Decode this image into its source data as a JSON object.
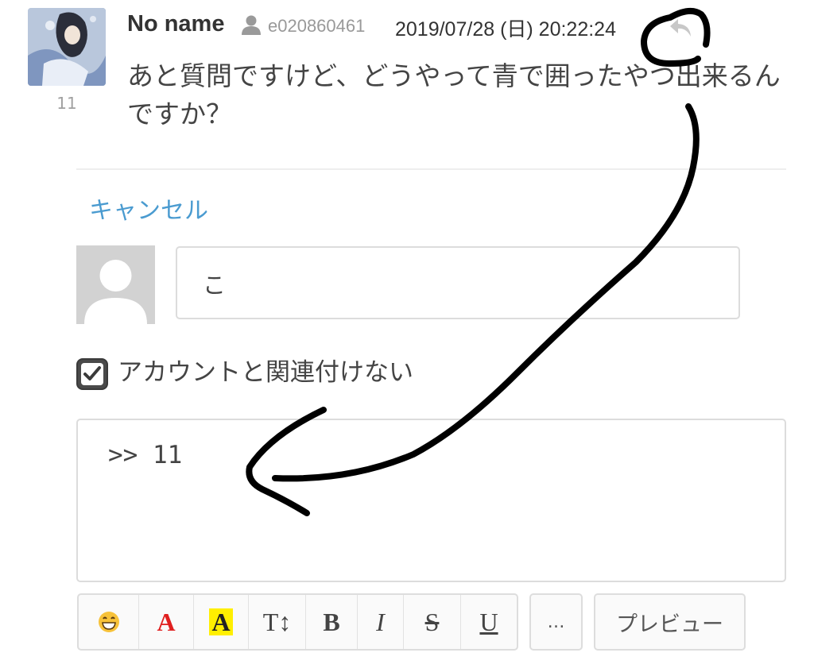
{
  "comment": {
    "author": "No name",
    "user_id": "e020860461",
    "date": "2019/07/28 (日) 20:22:24",
    "post_number": "11",
    "body": "あと質問ですけど、どうやって青で囲ったやつ出来るんですか？"
  },
  "reply_form": {
    "cancel_label": "キャンセル",
    "name_value": "こ",
    "anon_checked": true,
    "anon_label": "アカウントと関連付けない",
    "reply_value": ">> 11"
  },
  "toolbar": {
    "emoji_icon": "smiley-icon",
    "font_color": "A",
    "font_color_hex": "#e02020",
    "highlight": "A",
    "highlight_hex": "#ffef00",
    "font_size": "T↕",
    "bold": "B",
    "italic": "I",
    "strike": "S",
    "underline": "U",
    "more": "…",
    "preview": "プレビュー"
  },
  "colors": {
    "link": "#4a9bd0",
    "border": "#dcdcdc",
    "annotation_ink": "#000000"
  }
}
